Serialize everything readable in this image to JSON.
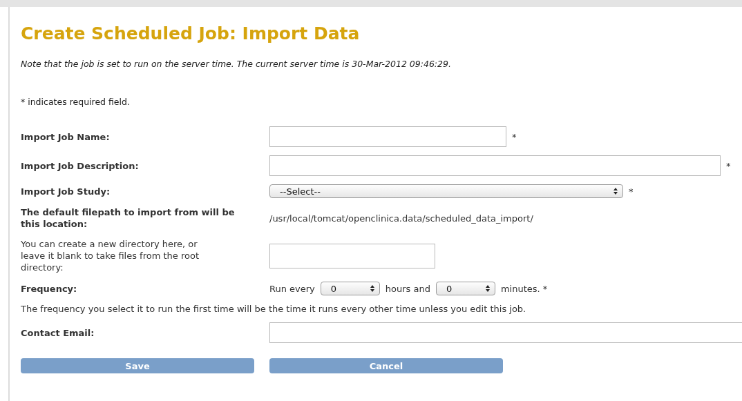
{
  "title": "Create Scheduled Job: Import Data",
  "note": "Note that the job is set to run on the server time. The current server time is 30-Mar-2012 09:46:29.",
  "required_note": "* indicates required field.",
  "rows": [
    {
      "kind": "short_text",
      "label": "Import Job Name:",
      "mark": "*"
    },
    {
      "kind": "long_text",
      "label": "Import Job Description:",
      "mark": "*"
    },
    {
      "kind": "select",
      "label": "Import Job Study:",
      "value": "--Select--",
      "mark": "*"
    },
    {
      "kind": "info",
      "label": "The default filepath to import from will be this location:",
      "value": "/usr/local/tomcat/openclinica.data/scheduled_data_import/"
    },
    {
      "kind": "directory",
      "label": "You can create a new directory here, or leave it blank to take files from the root directory:"
    },
    {
      "kind": "frequency",
      "label": "Frequency:",
      "prefix": "Run every",
      "hours": "0",
      "middle": "hours and",
      "minutes": "0",
      "suffix": "minutes. *"
    },
    {
      "kind": "note",
      "label": "The frequency you select it to run the first time will be the time it runs every other time unless you edit this job."
    },
    {
      "kind": "email",
      "label": "Contact Email:"
    }
  ],
  "buttons": [
    "Save",
    "Cancel"
  ]
}
